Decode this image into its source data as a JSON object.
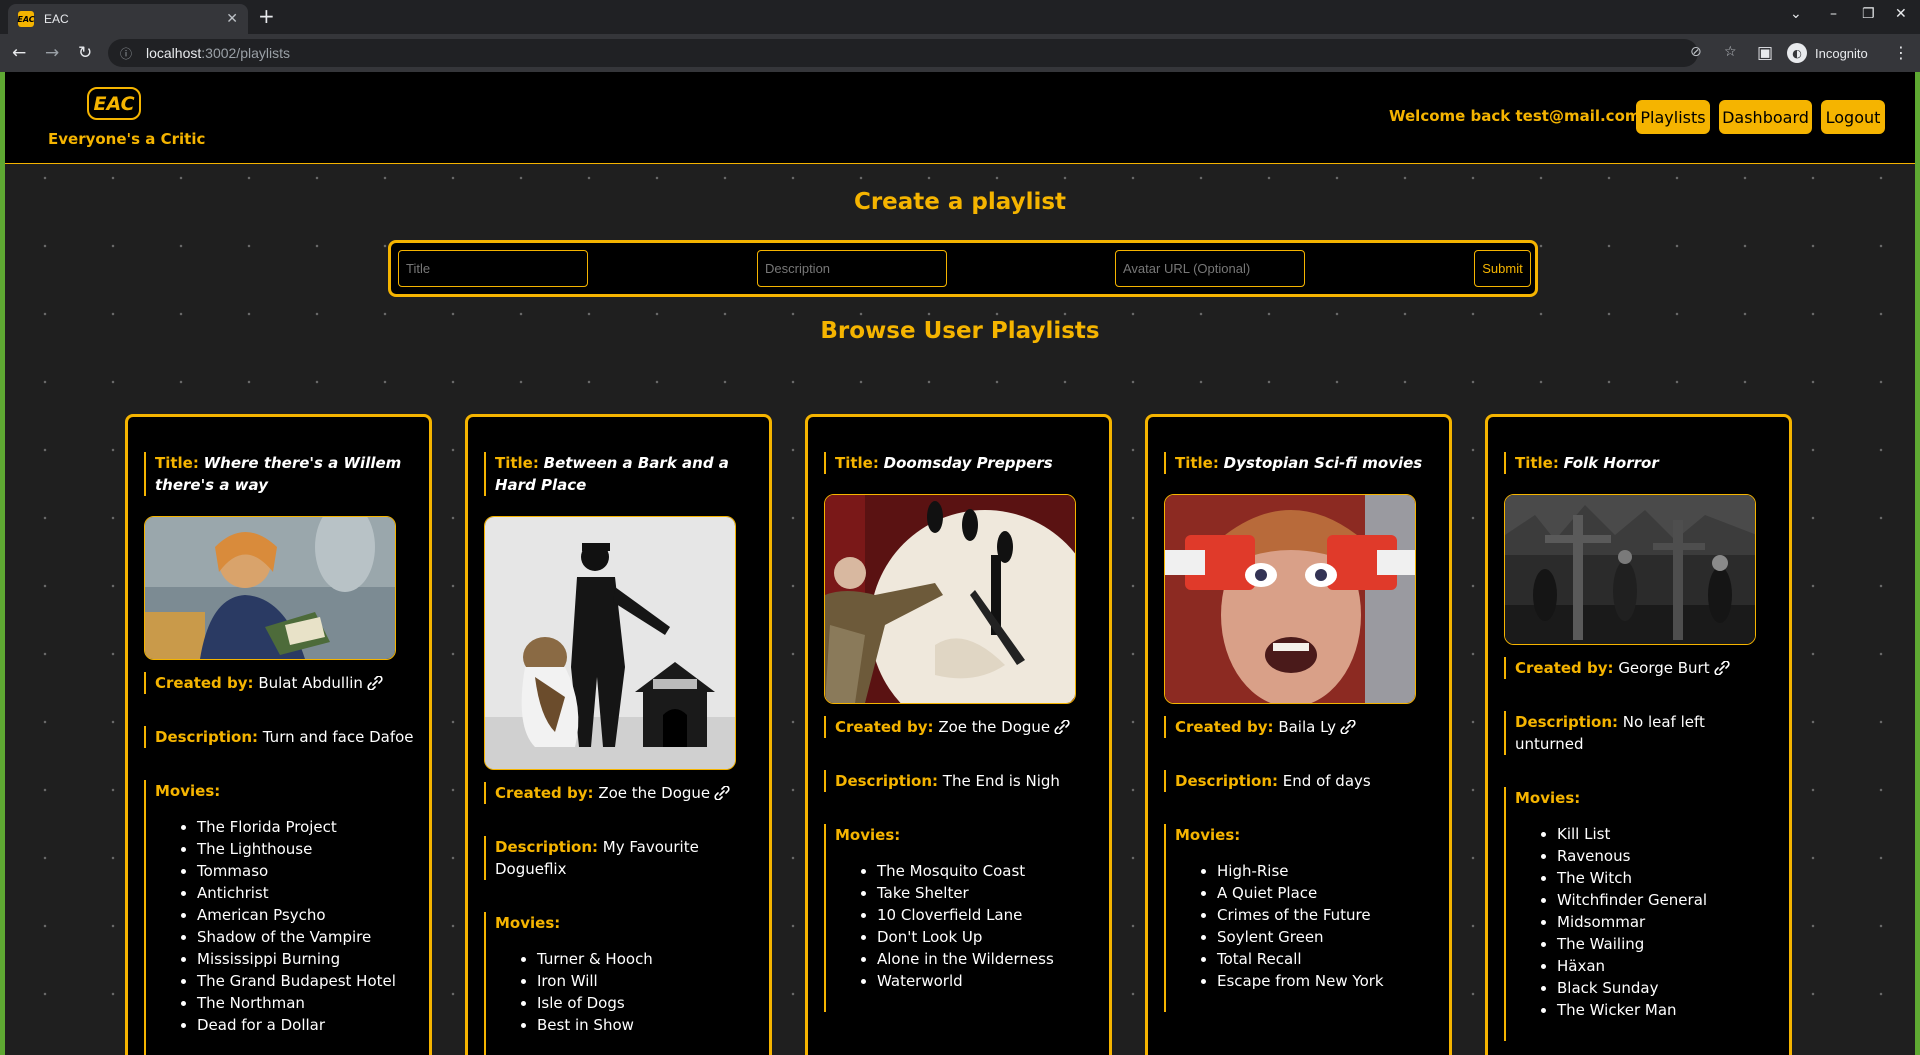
{
  "browser": {
    "tab_title": "EAC",
    "favicon_text": "EAC",
    "url_host": "localhost",
    "url_path": ":3002/playlists",
    "profile_label": "Incognito"
  },
  "header": {
    "logo_badge": "EAC",
    "logo_text": "Everyone's a Critic",
    "welcome": "Welcome back test@mail.com!",
    "nav": {
      "playlists": "Playlists",
      "dashboard": "Dashboard",
      "logout": "Logout"
    }
  },
  "create": {
    "heading": "Create a playlist",
    "title_placeholder": "Title",
    "description_placeholder": "Description",
    "avatar_placeholder": "Avatar URL (Optional)",
    "submit": "Submit"
  },
  "browse": {
    "heading": "Browse User Playlists"
  },
  "labels": {
    "title": "Title:",
    "created_by": "Created by:",
    "description": "Description:",
    "movies": "Movies:"
  },
  "colors": {
    "accent": "#f5b400",
    "background": "#1f1f1f",
    "card": "#000000"
  },
  "playlists": [
    {
      "title": "Where there's a Willem there's a way",
      "creator": "Bulat Abdullin",
      "description": "Turn and face Dafoe",
      "image": "man-reading-book-photo",
      "movies": [
        "The Florida Project",
        "The Lighthouse",
        "Tommaso",
        "Antichrist",
        "American Psycho",
        "Shadow of the Vampire",
        "Mississippi Burning",
        "The Grand Budapest Hotel",
        "The Northman",
        "Dead for a Dollar"
      ]
    },
    {
      "title": "Between a Bark and a Hard Place",
      "creator": "Zoe the Dogue",
      "description": "My Favourite Dogueflix",
      "image": "man-with-dog-and-kennel-photo",
      "movies": [
        "Turner & Hooch",
        "Iron Will",
        "Isle of Dogs",
        "Best in Show"
      ]
    },
    {
      "title": "Doomsday Preppers",
      "creator": "Zoe the Dogue",
      "description": "The End is Nigh",
      "image": "doomsday-clock-photo",
      "movies": [
        "The Mosquito Coast",
        "Take Shelter",
        "10 Cloverfield Lane",
        "Don't Look Up",
        "Alone in the Wilderness",
        "Waterworld"
      ]
    },
    {
      "title": "Dystopian Sci-fi movies",
      "creator": "Baila Ly",
      "description": "End of days",
      "image": "eye-clamp-device-photo",
      "movies": [
        "High-Rise",
        "A Quiet Place",
        "Crimes of the Future",
        "Soylent Green",
        "Total Recall",
        "Escape from New York"
      ]
    },
    {
      "title": "Folk Horror",
      "creator": "George Burt",
      "description": "No leaf left unturned",
      "image": "folk-ritual-night-photo",
      "movies": [
        "Kill List",
        "Ravenous",
        "The Witch",
        "Witchfinder General",
        "Midsommar",
        "The Wailing",
        "Häxan",
        "Black Sunday",
        "The Wicker Man"
      ]
    }
  ]
}
